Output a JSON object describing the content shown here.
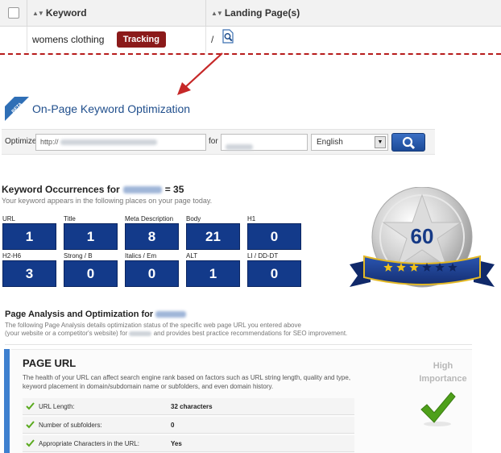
{
  "table": {
    "headers": {
      "keyword": "Keyword",
      "landing_pages": "Landing Page(s)"
    },
    "row": {
      "keyword": "womens clothing",
      "tracking_label": "Tracking",
      "landing_page": "/"
    }
  },
  "tool": {
    "badge_label": "BETA",
    "title": "On-Page Keyword Optimization",
    "optimize_label": "Optimize",
    "url_value": "http://",
    "for_label": "for",
    "language": "English"
  },
  "occurrences": {
    "title_prefix": "Keyword Occurrences for",
    "title_suffix": "= 35",
    "subtitle": "Your keyword appears in the following places on your page today.",
    "stats": [
      {
        "label": "URL",
        "value": "1"
      },
      {
        "label": "Title",
        "value": "1"
      },
      {
        "label": "Meta Description",
        "value": "8"
      },
      {
        "label": "Body",
        "value": "21"
      },
      {
        "label": "H1",
        "value": "0"
      },
      {
        "label": "H2-H6",
        "value": "3"
      },
      {
        "label": "Strong / B",
        "value": "0"
      },
      {
        "label": "Italics / Em",
        "value": "0"
      },
      {
        "label": "ALT",
        "value": "1"
      },
      {
        "label": "LI / DD-DT",
        "value": "0"
      }
    ],
    "score": "60",
    "stars_filled": 3,
    "stars_total": 6
  },
  "analysis": {
    "title": "Page Analysis and Optimization for",
    "desc_line1": "The following Page Analysis details optimization status of the specific web page URL you entered above",
    "desc_line2_a": "(your website or a competitor's website) for",
    "desc_line2_b": "and provides best practice recommendations for SEO improvement."
  },
  "page_url": {
    "title": "PAGE URL",
    "description": "The health of your URL can affect search engine rank based on factors such as URL string length, quality and type, keyword placement in domain/subdomain name or subfolders, and even domain history.",
    "importance_line1": "High",
    "importance_line2": "Importance",
    "rows": [
      {
        "label": "URL Length:",
        "value": "32 characters"
      },
      {
        "label": "Number of subfolders:",
        "value": "0"
      },
      {
        "label": "Appropriate Characters in the URL:",
        "value": "Yes"
      }
    ]
  },
  "colors": {
    "tracking": "#8b1a1a",
    "stat_box": "#133a8a",
    "accent_blue": "#1f4e8c",
    "card_bar": "#3e80cf",
    "check_green": "#5aaa1e",
    "dash_red": "#b71c1c"
  }
}
